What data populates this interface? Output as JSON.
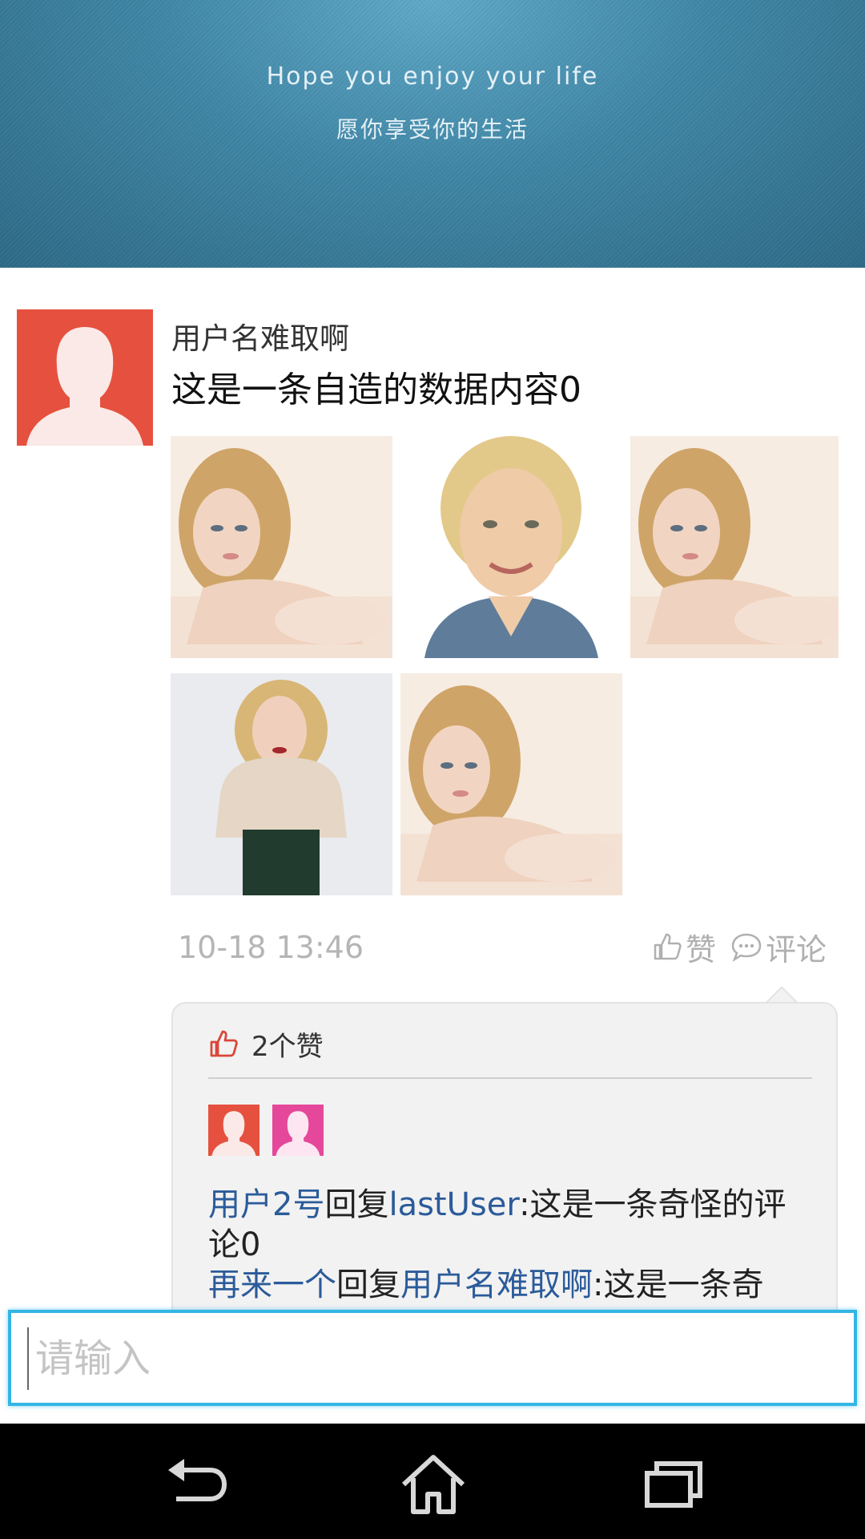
{
  "banner": {
    "line_en": "Hope you enjoy your life",
    "line_cn": "愿你享受你的生活"
  },
  "post": {
    "avatar_icon": "user-avatar-icon",
    "username": "用户名难取啊",
    "text": "这是一条自造的数据内容0",
    "photos": [
      "photo-reclining",
      "photo-portrait-smile",
      "photo-reclining",
      "photo-standing",
      "photo-reclining"
    ],
    "timestamp": "10-18 13:46",
    "like_label": "赞",
    "comment_label": "评论"
  },
  "likes": {
    "count_label": "2个赞",
    "avatar_colors": [
      "#e5513e",
      "#e5479a"
    ]
  },
  "comments": [
    {
      "from": "用户2号",
      "verb": "回复",
      "to": "lastUser",
      "text": ":这是一条奇怪的评论0"
    },
    {
      "from": "再来一个",
      "verb": "回复",
      "to": "用户名难取啊",
      "text": ":这是一条奇"
    }
  ],
  "input": {
    "placeholder": "请输入"
  },
  "navbar": {
    "icons": [
      "back-icon",
      "home-icon",
      "recent-apps-icon"
    ]
  },
  "colors": {
    "accent": "#33b5e5",
    "link": "#2b5b9a",
    "avatar_red": "#e5513e"
  }
}
